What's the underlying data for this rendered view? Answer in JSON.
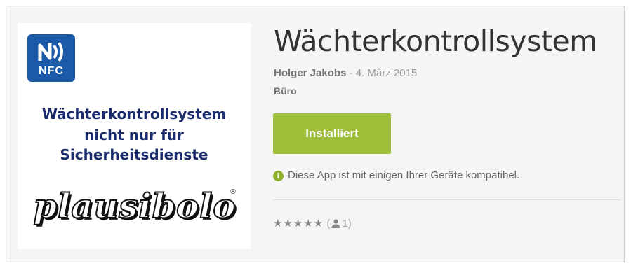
{
  "app": {
    "title": "Wächterkontrollsystem",
    "author": "Holger Jakobs",
    "date_sep": " - ",
    "date": "4. März 2015",
    "category": "Büro",
    "install_label": "Installiert",
    "compat_text": "Diese App ist mit einigen Ihrer Geräte kompatibel.",
    "rating": {
      "stars_text": "★★★★★",
      "open_paren": "(",
      "count": "1",
      "close_paren": ")",
      "icon": "person-icon"
    }
  },
  "cover": {
    "nfc_label": "NFC",
    "line1": "Wächterkontrollsystem",
    "line2": "nicht nur für",
    "line3": "Sicherheitsdienste",
    "brand": "plausibolo",
    "brand_mark": "®"
  },
  "colors": {
    "install_button": "#9fbf3b",
    "nfc_badge": "#1b5aa8",
    "cover_text": "#1a2b6d",
    "info_icon": "#8cae2c"
  }
}
